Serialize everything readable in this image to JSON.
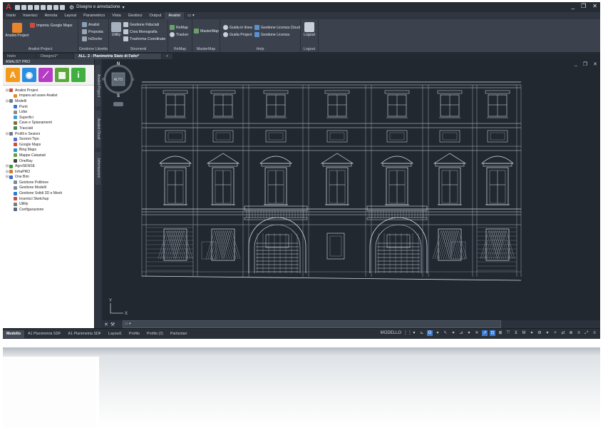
{
  "app": {
    "title": "Disegno e annotazione",
    "logo_letter": "A",
    "window_buttons": [
      "_",
      "❐",
      "✕"
    ]
  },
  "menu": {
    "tabs": [
      "Inizio",
      "Inserisci",
      "Annota",
      "Layout",
      "Parametrico",
      "Vista",
      "Gestisci",
      "Output",
      "Analist"
    ],
    "active": "Analist"
  },
  "ribbon": {
    "groups": [
      {
        "label": "Analist Project",
        "buttons": [
          "Analist Project",
          "Importa",
          "Google Maps"
        ]
      },
      {
        "label": "Gestione Libretto",
        "buttons": [
          "Analist",
          "Proposta",
          "InDoche"
        ]
      },
      {
        "label": "Strumenti",
        "buttons": [
          "Utility",
          "Gestione Fiduciali",
          "Crea Monografia",
          "Trasforma Coordinate"
        ]
      },
      {
        "label": "ReMap",
        "buttons": [
          "ReMap",
          "Tracker"
        ]
      },
      {
        "label": "MasterMap",
        "buttons": [
          "MasterMap"
        ]
      },
      {
        "label": "Help",
        "buttons": [
          "Guida in linea",
          "Guida Project",
          "Gestione Licenza Cloud",
          "Gestione Licenza"
        ]
      },
      {
        "label": "Logout",
        "buttons": [
          "Logout"
        ]
      }
    ]
  },
  "doc_tabs": [
    "Inizio",
    "Disegno1*",
    "ALL. 2 - Planimetria Stato di Fatto*",
    "+"
  ],
  "doc_tab_active": "ALL. 2 - Planimetria Stato di Fatto*",
  "left_panel": {
    "title": "ANALIST PRO",
    "tools": [
      {
        "letter": "A",
        "color": "#f39a1d"
      },
      {
        "letter": "◉",
        "color": "#2a8de0"
      },
      {
        "letter": "⟋",
        "color": "#b43dc4"
      },
      {
        "letter": "▦",
        "color": "#5aa83a"
      },
      {
        "letter": "i",
        "color": "#3faf3f"
      }
    ],
    "tree": [
      {
        "label": "Analist Project",
        "level": 0,
        "color": "#d24a3a"
      },
      {
        "label": "Impara ad usare Analist",
        "level": 1,
        "color": "#e08a2a"
      },
      {
        "label": "Modelli",
        "level": 0,
        "color": "#6d7c8c"
      },
      {
        "label": "Punti",
        "level": 1,
        "color": "#3b6fd0"
      },
      {
        "label": "Lidar",
        "level": 1,
        "color": "#8a8a8a"
      },
      {
        "label": "Superfici",
        "level": 1,
        "color": "#3aa0d0"
      },
      {
        "label": "Cave e Spianamenti",
        "level": 1,
        "color": "#8a6a3a"
      },
      {
        "label": "Tracciati",
        "level": 1,
        "color": "#3a8a5a"
      },
      {
        "label": "Profili e Sezioni",
        "level": 0,
        "color": "#6d7c8c"
      },
      {
        "label": "Sezioni Tipo",
        "level": 1,
        "color": "#5a6ad0"
      },
      {
        "label": "Google Maps",
        "level": 1,
        "color": "#d04a3a"
      },
      {
        "label": "Bing Maps",
        "level": 1,
        "color": "#2a90d0"
      },
      {
        "label": "Mappe Catastali",
        "level": 1,
        "color": "#5aa83a"
      },
      {
        "label": "OneRay",
        "level": 1,
        "color": "#404040"
      },
      {
        "label": "AgroSENSE",
        "level": 0,
        "color": "#3a9a3a"
      },
      {
        "label": "InfraPRO",
        "level": 0,
        "color": "#d07a2a"
      },
      {
        "label": "One Bim",
        "level": 0,
        "color": "#3a6ad0"
      },
      {
        "label": "Gestione Polilinee",
        "level": 1,
        "color": "#7a8a9a"
      },
      {
        "label": "Gestione Modelli",
        "level": 1,
        "color": "#7a8a9a"
      },
      {
        "label": "Gestione Solidi 3D e Mesh",
        "level": 1,
        "color": "#2a7ad0"
      },
      {
        "label": "Inserisci Sketchup",
        "level": 1,
        "color": "#d04a3a"
      },
      {
        "label": "Utility",
        "level": 1,
        "color": "#7a7a7a"
      },
      {
        "label": "Configurazione",
        "level": 1,
        "color": "#5a6a7a"
      }
    ]
  },
  "vertical_tabs": [
    "Analist Project",
    "Analist Cloud",
    "Informazioni"
  ],
  "viewcube": {
    "north": "N",
    "south": "S",
    "east": "E",
    "west": "W",
    "face": "ALTO"
  },
  "view_controls": [
    "_",
    "❐",
    "✕"
  ],
  "command_line": {
    "icons": [
      "✕",
      "🔧"
    ],
    "placeholder": "▭ ▾"
  },
  "layout_tabs": [
    "Modello",
    "A1 Planimetria SDF",
    "A1 Planimetria SDF",
    "Layout1",
    "Profilo",
    "Profilo (2)",
    "Particolari"
  ],
  "layout_active": "Modello",
  "status": {
    "mode": "MODELLO",
    "icons": [
      "⋮⋮",
      "▾",
      "⊾",
      "G",
      "▾",
      "↖",
      "▾",
      "⊿",
      "▾",
      "✕",
      "↗",
      "⊡",
      "⊠",
      "⤧",
      "⊻",
      "M",
      "▾",
      "⚙",
      "▾",
      "+",
      "⇄",
      "⊕",
      "≡",
      "⤢",
      "≡"
    ]
  }
}
